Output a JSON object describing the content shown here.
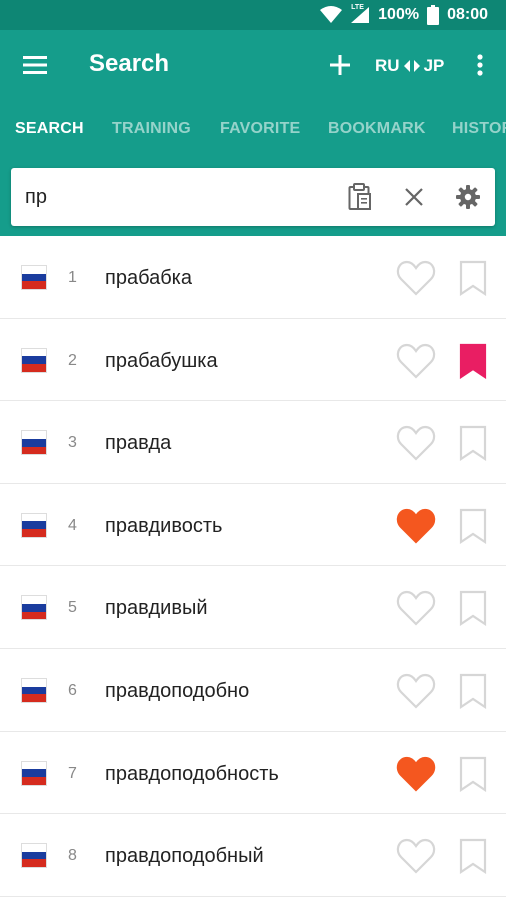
{
  "status_bar": {
    "battery": "100%",
    "time": "08:00",
    "network": "LTE"
  },
  "app_bar": {
    "title": "Search",
    "lang_from": "RU",
    "lang_to": "JP"
  },
  "tabs": [
    {
      "label": "SEARCH",
      "active": true
    },
    {
      "label": "TRAINING",
      "active": false
    },
    {
      "label": "FAVORITE",
      "active": false
    },
    {
      "label": "BOOKMARK",
      "active": false
    },
    {
      "label": "HISTORY",
      "active": false
    }
  ],
  "search": {
    "value": "пр"
  },
  "colors": {
    "primary": "#159d8b",
    "status_bar": "#0e8674",
    "favorite": "#f4571f",
    "bookmark": "#e91e63",
    "icon_outline": "#d6d6d6"
  },
  "results": [
    {
      "num": "1",
      "word": "прабабка",
      "favorite": false,
      "bookmarked": false
    },
    {
      "num": "2",
      "word": "прабабушка",
      "favorite": false,
      "bookmarked": true
    },
    {
      "num": "3",
      "word": "правда",
      "favorite": false,
      "bookmarked": false
    },
    {
      "num": "4",
      "word": "правдивость",
      "favorite": true,
      "bookmarked": false
    },
    {
      "num": "5",
      "word": "правдивый",
      "favorite": false,
      "bookmarked": false
    },
    {
      "num": "6",
      "word": "правдоподобно",
      "favorite": false,
      "bookmarked": false
    },
    {
      "num": "7",
      "word": "правдоподобность",
      "favorite": true,
      "bookmarked": false
    },
    {
      "num": "8",
      "word": "правдоподобный",
      "favorite": false,
      "bookmarked": false
    }
  ]
}
